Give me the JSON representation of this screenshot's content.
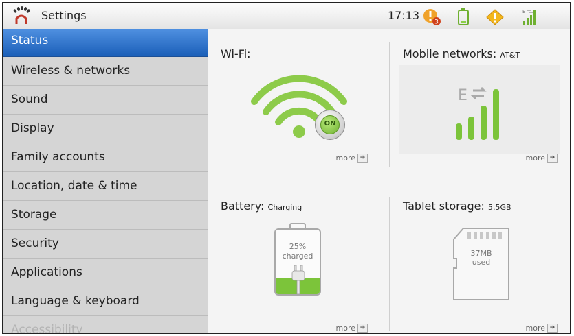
{
  "statusbar": {
    "app_title": "Settings",
    "time": "17:13",
    "notification_count": "3",
    "icons": [
      "app-logo-icon",
      "alert-notification-icon",
      "battery-icon",
      "warning-icon",
      "signal-edge-icon"
    ]
  },
  "sidebar": {
    "items": [
      {
        "label": "Status",
        "selected": true
      },
      {
        "label": "Wireless & networks"
      },
      {
        "label": "Sound"
      },
      {
        "label": "Display"
      },
      {
        "label": "Family accounts"
      },
      {
        "label": "Location, date & time"
      },
      {
        "label": "Storage"
      },
      {
        "label": "Security"
      },
      {
        "label": "Applications"
      },
      {
        "label": "Language & keyboard"
      },
      {
        "label": "Accessibility"
      }
    ]
  },
  "panels": {
    "wifi": {
      "title": "Wi-Fi:",
      "toggle": "ON",
      "more": "more"
    },
    "mobile": {
      "title": "Mobile networks:",
      "carrier": "AT&T",
      "network_type": "E",
      "more": "more"
    },
    "battery": {
      "title": "Battery:",
      "state": "Charging",
      "percent": "25%",
      "percent_label": "charged",
      "level": 0.25,
      "more": "more"
    },
    "storage": {
      "title": "Tablet storage:",
      "capacity": "5.5GB",
      "used": "37MB",
      "used_label": "used",
      "more": "more"
    }
  },
  "colors": {
    "accent_blue": "#2a6fcc",
    "green": "#7cc43a",
    "sidebar_bg": "#d5d5d5",
    "main_bg": "#f4f4f4"
  }
}
